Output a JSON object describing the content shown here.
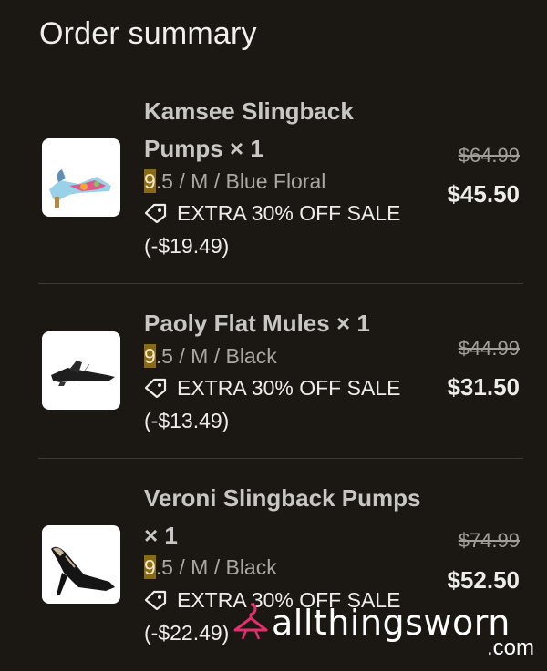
{
  "header": {
    "title": "Order summary"
  },
  "items": [
    {
      "name": "Kamsee Slingback Pumps × 1",
      "size_highlight": "9",
      "variant_rest": ".5 / M / Blue Floral",
      "promo": "EXTRA 30% OFF SALE (-$19.49)",
      "old_price": "$64.99",
      "new_price": "$45.50",
      "image": "floral-slingback-pump"
    },
    {
      "name": "Paoly Flat Mules × 1",
      "size_highlight": "9",
      "variant_rest": ".5 / M / Black",
      "promo": "EXTRA 30% OFF SALE (-$13.49)",
      "old_price": "$44.99",
      "new_price": "$31.50",
      "image": "black-flat-mule"
    },
    {
      "name": "Veroni Slingback Pumps × 1",
      "size_highlight": "9",
      "variant_rest": ".5 / M / Black",
      "promo": "EXTRA 30% OFF SALE (-$22.49)",
      "old_price": "$74.99",
      "new_price": "$52.50",
      "image": "black-slingback-pump"
    }
  ],
  "watermark": {
    "brand": "allthingsworn",
    "suffix": ".com"
  },
  "colors": {
    "background": "#1b1814",
    "highlight": "#8a6b14",
    "watermark_accent": "#e0306e"
  },
  "icons": {
    "promo": "tag-icon",
    "watermark": "hanger-icon"
  }
}
